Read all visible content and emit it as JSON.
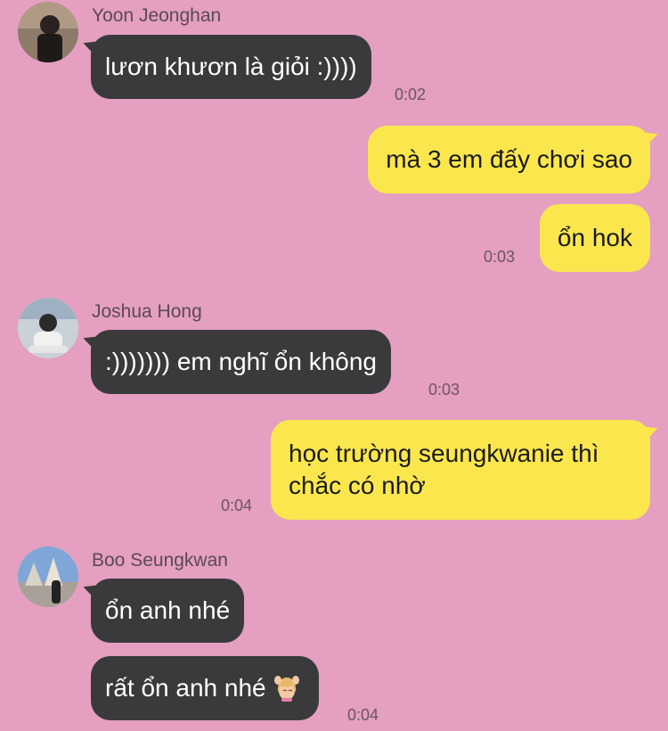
{
  "chat": {
    "messages": [
      {
        "sender": "Yoon Jeonghan",
        "text": "lươn khươn là giỏi :))))",
        "time": "0:02"
      },
      {
        "text": "mà 3 em đấy chơi sao"
      },
      {
        "text": "ổn hok",
        "time": "0:03"
      },
      {
        "sender": "Joshua Hong",
        "text": ":))))))) em nghĩ ổn không",
        "time": "0:03"
      },
      {
        "text_line1": "học trường seungkwanie thì",
        "text_line2": "chắc có nhờ",
        "time": "0:04"
      },
      {
        "sender": "Boo Seungkwan",
        "text": "ổn anh nhé"
      },
      {
        "text": "rất ổn anh nhé",
        "emoji": "woman-raising-hands-emoji",
        "time": "0:04"
      }
    ]
  },
  "colors": {
    "background": "#E59FC0",
    "incoming_bubble": "#3A3A3C",
    "outgoing_bubble": "#FBE74D"
  }
}
